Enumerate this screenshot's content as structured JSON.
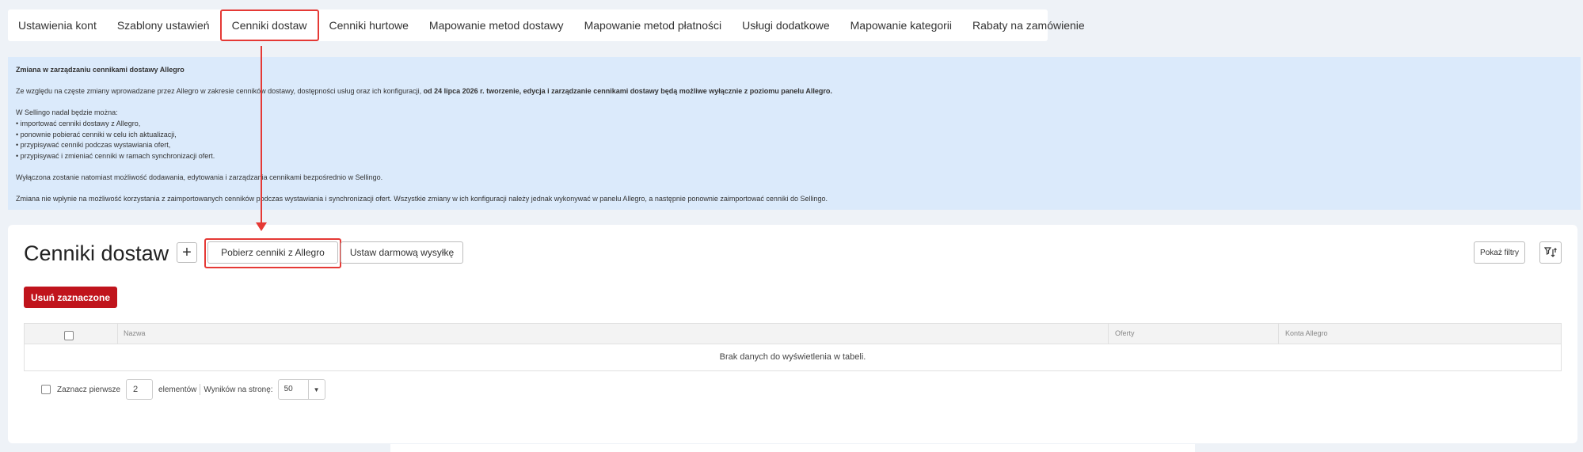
{
  "tabs": [
    {
      "label": "Ustawienia kont"
    },
    {
      "label": "Szablony ustawień"
    },
    {
      "label": "Cenniki dostaw",
      "active": true
    },
    {
      "label": "Cenniki hurtowe"
    },
    {
      "label": "Mapowanie metod dostawy"
    },
    {
      "label": "Mapowanie metod płatności"
    },
    {
      "label": "Usługi dodatkowe"
    },
    {
      "label": "Mapowanie kategorii"
    },
    {
      "label": "Rabaty na zamówienie"
    }
  ],
  "notice": {
    "title": "Zmiana w zarządzaniu cennikami dostawy Allegro",
    "para1_start": "Ze względu na częste zmiany wprowadzane przez Allegro w zakresie cenników dostawy, dostępności usług oraz ich konfiguracji, ",
    "para1_bold": "od 24 lipca 2026 r. tworzenie, edycja i zarządzanie cennikami dostawy będą możliwe wyłącznie z poziomu panelu Allegro.",
    "list_intro": "W Sellingo nadal będzie można:",
    "list": [
      "• importować cenniki dostawy z Allegro,",
      "• ponownie pobierać cenniki w celu ich aktualizacji,",
      "• przypisywać cenniki podczas wystawiania ofert,",
      "• przypisywać i zmieniać cenniki w ramach synchronizacji ofert."
    ],
    "para2": "Wyłączona zostanie natomiast możliwość dodawania, edytowania i zarządzania cennikami bezpośrednio w Sellingo.",
    "para3": "Zmiana nie wpłynie na możliwość korzystania z zaimportowanych cenników podczas wystawiania i synchronizacji ofert. Wszystkie zmiany w ich konfiguracji należy jednak wykonywać w panelu Allegro, a następnie ponownie zaimportować cenniki do Sellingo."
  },
  "main": {
    "title": "Cenniki dostaw",
    "add_label": "+",
    "fetch_label": "Pobierz cenniki z Allegro",
    "free_shipping_label": "Ustaw darmową wysyłkę",
    "filters_label": "Pokaż filtry",
    "sort_icon": "filter-sort-icon",
    "delete_label": "Usuń zaznaczone"
  },
  "table": {
    "columns": [
      "Nazwa",
      "Oferty",
      "Konta Allegro"
    ],
    "empty_text": "Brak danych do wyświetlenia w tabeli."
  },
  "pager": {
    "select_first_label": "Zaznacz pierwsze",
    "count_value": "2",
    "elements_label": "elementów",
    "per_page_label": "Wyników na stronę:",
    "per_page_value": "50"
  },
  "colors": {
    "accent": "#e53935",
    "danger": "#c0141c",
    "notice_bg": "#dbeafb"
  }
}
